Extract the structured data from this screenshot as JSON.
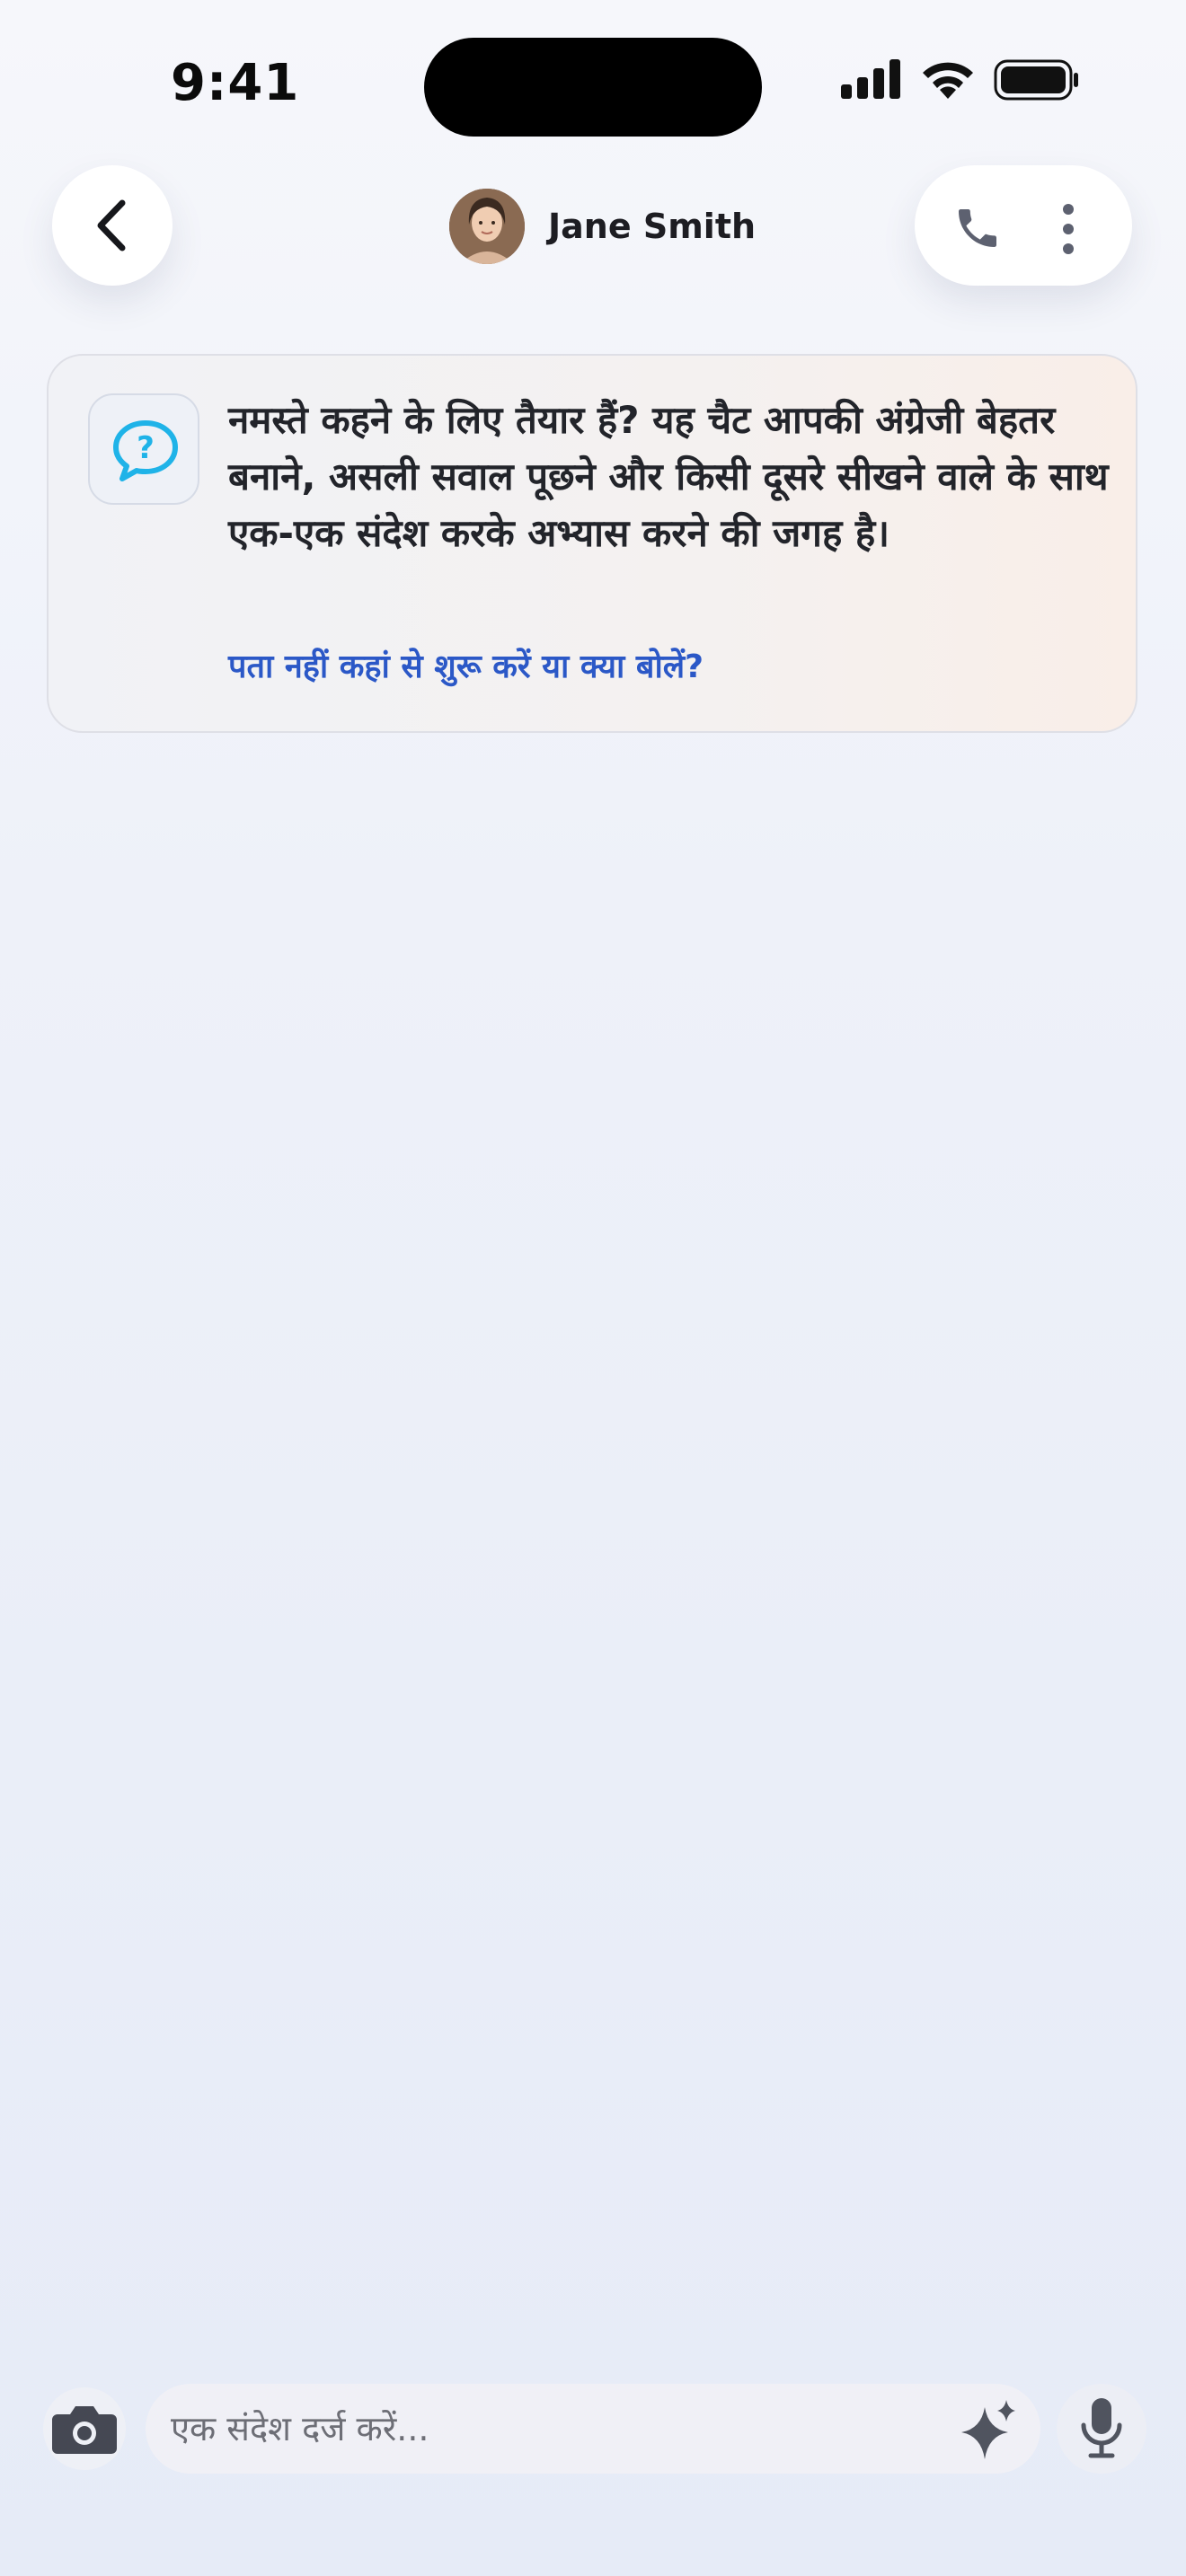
{
  "status_bar": {
    "time": "9:41"
  },
  "header": {
    "contact_name": "Jane Smith",
    "icons": {
      "back": "chevron-left-icon",
      "call": "phone-icon",
      "more": "more-vertical-icon"
    }
  },
  "intro_card": {
    "icon": "question-chat-icon",
    "text": "नमस्ते कहने के लिए तैयार हैं? यह चैट आपकी अंग्रेजी बेहतर बनाने, असली सवाल पूछने और किसी दूसरे सीखने वाले के साथ एक-एक संदेश करके अभ्यास करने की जगह है।",
    "link": "पता नहीं कहां से शुरू करें या क्या बोलें?"
  },
  "composer": {
    "placeholder": "एक संदेश दर्ज करें...",
    "icons": {
      "camera": "camera-icon",
      "ai": "sparkle-icon",
      "mic": "microphone-icon"
    }
  },
  "colors": {
    "link": "#2b58c7",
    "help_icon": "#1fb3e8",
    "text": "#22242a",
    "icon_gray": "#5d6170"
  }
}
